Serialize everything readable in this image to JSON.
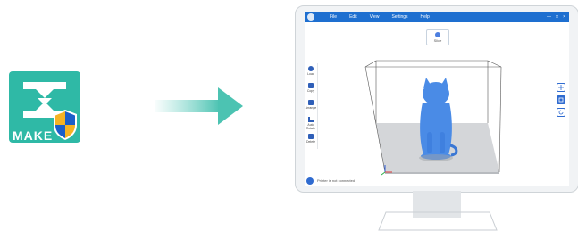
{
  "app_icon": {
    "label": "MAKE"
  },
  "app": {
    "menu": [
      "File",
      "Edit",
      "View",
      "Settings",
      "Help"
    ],
    "window_controls": [
      "—",
      "□",
      "×"
    ],
    "slice_button": "Slice",
    "left_tools": [
      "Load",
      "Copy",
      "Arrange",
      "Auto Rotate",
      "Delete"
    ],
    "status": "Printer is not connected"
  },
  "colors": {
    "brand": "#2fb9a6",
    "accent": "#1e6fd0",
    "model": "#4a8be6",
    "shield_blue": "#1b5fc9",
    "shield_yellow": "#f5b323"
  }
}
